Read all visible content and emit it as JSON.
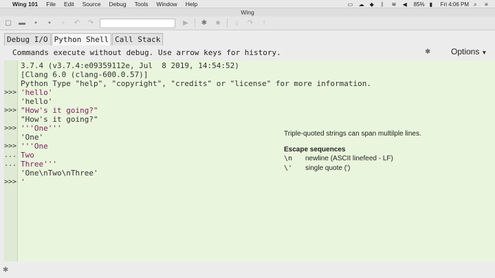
{
  "menubar": {
    "app": "Wing 101",
    "items": [
      "File",
      "Edit",
      "Source",
      "Debug",
      "Tools",
      "Window",
      "Help"
    ],
    "battery": "85%",
    "clock": "Fri 4:06 PM"
  },
  "window": {
    "title": "Wing"
  },
  "tabs": [
    "Debug I/O",
    "Python Shell",
    "Call Stack"
  ],
  "shell": {
    "info": "Commands execute without debug.  Use arrow keys for history.",
    "options_label": "Options",
    "lines": [
      {
        "prompt": "",
        "text": "3.7.4 (v3.7.4:e09359112e, Jul  8 2019, 14:54:52)"
      },
      {
        "prompt": "",
        "text": "[Clang 6.0 (clang-600.0.57)]"
      },
      {
        "prompt": "",
        "text": "Python Type \"help\", \"copyright\", \"credits\" or \"license\" for more information."
      },
      {
        "prompt": ">>>",
        "text": "'hello'"
      },
      {
        "prompt": "",
        "text": "'hello'"
      },
      {
        "prompt": ">>>",
        "text": "\"How's it going?\""
      },
      {
        "prompt": "",
        "text": "\"How's it going?\""
      },
      {
        "prompt": ">>>",
        "text": "'''One'''"
      },
      {
        "prompt": "",
        "text": "'One'"
      },
      {
        "prompt": ">>>",
        "text": "'''One"
      },
      {
        "prompt": "...",
        "text": "Two"
      },
      {
        "prompt": "...",
        "text": "Three'''"
      },
      {
        "prompt": "",
        "text": "'One\\nTwo\\nThree'"
      },
      {
        "prompt": ">>>",
        "text": "'"
      }
    ]
  },
  "annotation": {
    "line1": "Triple-quoted strings can span multilple lines.",
    "heading": "Escape sequences",
    "escapes": [
      {
        "code": "\\n",
        "desc": "newline (ASCII linefeed - LF)"
      },
      {
        "code": "\\'",
        "desc": "single quote (')"
      }
    ]
  },
  "colors": {
    "shell_bg": "#e9f5dc",
    "string_color": "#7a1f5c"
  }
}
